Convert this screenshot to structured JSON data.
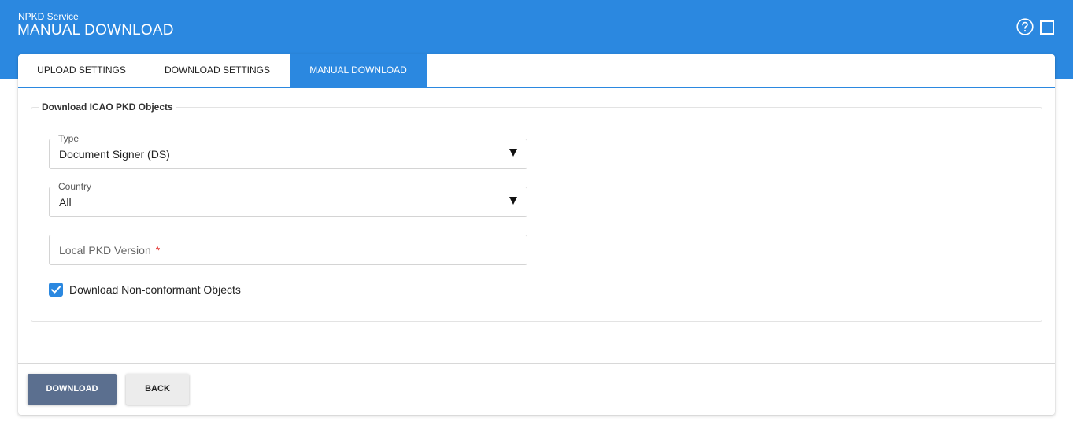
{
  "header": {
    "subtitle": "NPKD Service",
    "title": "MANUAL DOWNLOAD",
    "help_icon": "question-circle-icon",
    "window_icon": "square-icon",
    "color": "#2b88e0"
  },
  "tabs": [
    {
      "label": "UPLOAD SETTINGS",
      "active": false
    },
    {
      "label": "DOWNLOAD SETTINGS",
      "active": false
    },
    {
      "label": "MANUAL DOWNLOAD",
      "active": true
    }
  ],
  "form": {
    "legend": "Download ICAO PKD Objects",
    "type": {
      "label": "Type",
      "value": "Document Signer (DS)"
    },
    "country": {
      "label": "Country",
      "value": "All"
    },
    "local_pkd_version": {
      "placeholder": "Local PKD Version",
      "required_mark": "*",
      "value": ""
    },
    "non_conformant": {
      "label": "Download Non-conformant Objects",
      "checked": true
    }
  },
  "buttons": {
    "download": "DOWNLOAD",
    "back": "BACK"
  },
  "colors": {
    "accent": "#2b88e0",
    "primary_button": "#5b6f8f",
    "required": "#e53935"
  }
}
